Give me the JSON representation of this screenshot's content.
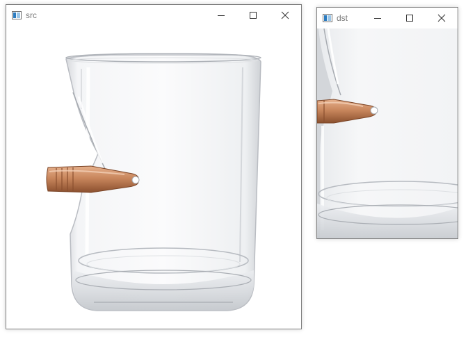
{
  "windows": {
    "src": {
      "title": "src",
      "controls": [
        "minimize-icon",
        "maximize-icon",
        "close-icon"
      ]
    },
    "dst": {
      "title": "dst",
      "controls": [
        "minimize-icon",
        "maximize-icon",
        "close-icon"
      ]
    }
  },
  "colors": {
    "title_text": "#7a7a7a",
    "border": "#7f7f7f",
    "glass_edge": "#b9bcc2",
    "bullet_copper": "#c9875d",
    "background": "#ffffff"
  }
}
